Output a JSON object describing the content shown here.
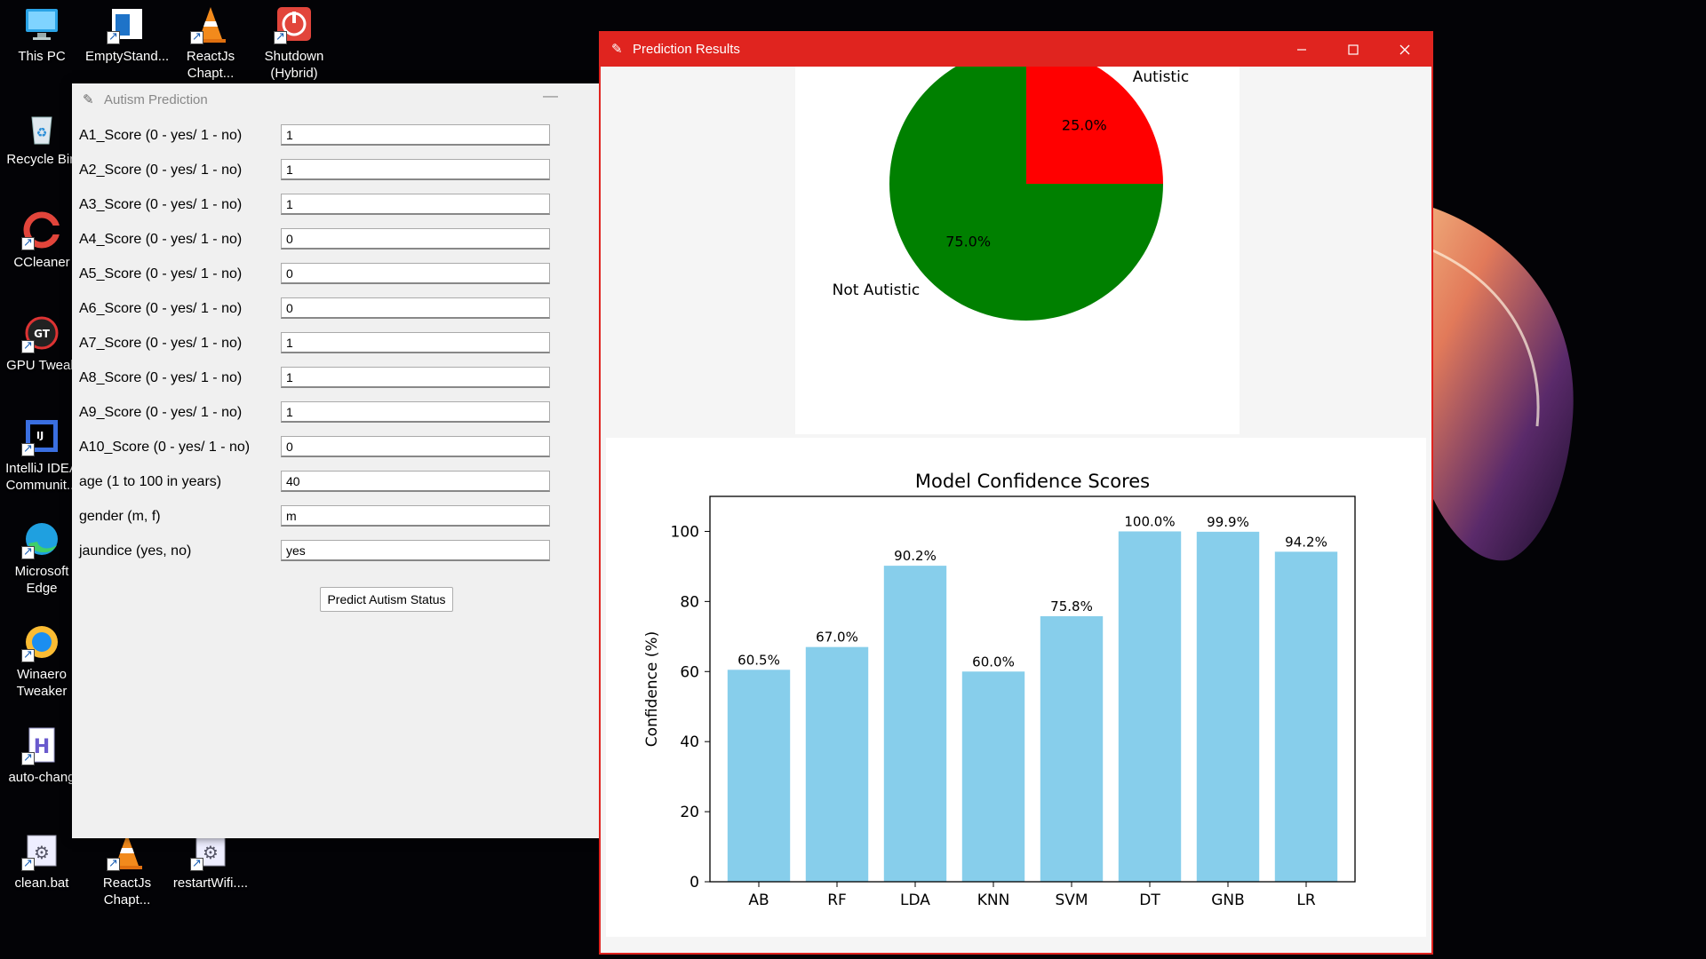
{
  "desktop": {
    "icons": [
      {
        "label": "This PC",
        "icon": "monitor-icon"
      },
      {
        "label": "EmptyStand...",
        "icon": "app-window-icon"
      },
      {
        "label": "ReactJs Chapt...",
        "icon": "vlc-cone-icon"
      },
      {
        "label": "Shutdown (Hybrid)",
        "icon": "power-icon"
      },
      {
        "label": "Recycle Bin",
        "icon": "recycle-bin-icon"
      },
      {
        "label": "CCleaner",
        "icon": "ccleaner-icon"
      },
      {
        "label": "GPU Tweak",
        "icon": "gpu-tweak-icon"
      },
      {
        "label": "IntelliJ IDEA Communit...",
        "icon": "intellij-icon"
      },
      {
        "label": "Microsoft Edge",
        "icon": "edge-icon"
      },
      {
        "label": "Winaero Tweaker",
        "icon": "winaero-icon"
      },
      {
        "label": "auto-chang",
        "icon": "document-icon"
      },
      {
        "label": "clean.bat",
        "icon": "batch-gear-icon"
      },
      {
        "label": "ReactJs Chapt...",
        "icon": "vlc-cone-icon"
      },
      {
        "label": "restartWifi....",
        "icon": "batch-gear-icon"
      }
    ]
  },
  "form_window": {
    "title": "Autism Prediction",
    "minimize_glyph": "—",
    "fields": [
      {
        "label": "A1_Score (0 - yes/ 1 - no)",
        "value": "1"
      },
      {
        "label": "A2_Score (0 - yes/ 1 - no)",
        "value": "1"
      },
      {
        "label": "A3_Score (0 - yes/ 1 - no)",
        "value": "1"
      },
      {
        "label": "A4_Score (0 - yes/ 1 - no)",
        "value": "0"
      },
      {
        "label": "A5_Score (0 - yes/ 1 - no)",
        "value": "0"
      },
      {
        "label": "A6_Score (0 - yes/ 1 - no)",
        "value": "0"
      },
      {
        "label": "A7_Score (0 - yes/ 1 - no)",
        "value": "1"
      },
      {
        "label": "A8_Score (0 - yes/ 1 - no)",
        "value": "1"
      },
      {
        "label": "A9_Score (0 - yes/ 1 - no)",
        "value": "1"
      },
      {
        "label": "A10_Score (0 - yes/ 1 - no)",
        "value": "0"
      },
      {
        "label": "age (1 to 100 in years)",
        "value": "40"
      },
      {
        "label": "gender (m, f)",
        "value": "m"
      },
      {
        "label": "jaundice (yes, no)",
        "value": "yes"
      }
    ],
    "predict_button": "Predict Autism Status"
  },
  "results_window": {
    "title": "Prediction Results",
    "accent": "#e0241f",
    "controls": {
      "minimize": "—",
      "maximize": "☐",
      "close": "✕"
    }
  },
  "chart_data": [
    {
      "type": "pie",
      "labels": [
        "Autistic",
        "Not Autistic"
      ],
      "values": [
        25.0,
        75.0
      ],
      "display": [
        "25.0%",
        "75.0%"
      ],
      "colors": [
        "#ff0000",
        "#008000"
      ]
    },
    {
      "type": "bar",
      "title": "Model Confidence Scores",
      "ylabel": "Confidence (%)",
      "categories": [
        "AB",
        "RF",
        "LDA",
        "KNN",
        "SVM",
        "DT",
        "GNB",
        "LR"
      ],
      "values": [
        60.5,
        67.0,
        90.2,
        60.0,
        75.8,
        100.0,
        99.9,
        94.2
      ],
      "value_labels": [
        "60.5%",
        "67.0%",
        "90.2%",
        "60.0%",
        "75.8%",
        "100.0%",
        "99.9%",
        "94.2%"
      ],
      "ylim": [
        0,
        110
      ],
      "yticks": [
        "0",
        "20",
        "40",
        "60",
        "80",
        "100"
      ],
      "bar_color": "#87ceeb"
    }
  ]
}
